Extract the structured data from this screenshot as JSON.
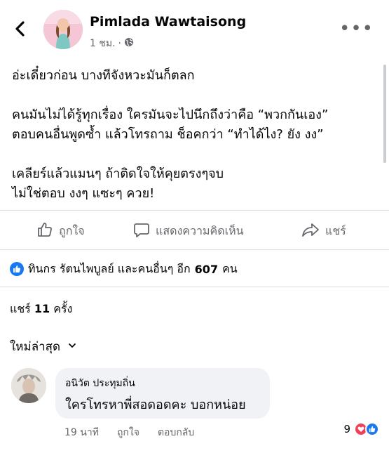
{
  "header": {
    "author": "Pimlada Wawtaisong",
    "time": "1 ชม.",
    "separator": "·",
    "more_label": "•••"
  },
  "post": {
    "lines": [
      "อ่ะเดี๋ยวก่อน บางทีจังหวะมันก็ตลก",
      "",
      "คนมันไม่ได้รู้ทุกเรื่อง ใครมันจะไปนึกถึงว่าคือ “พวกกันเอง”",
      "ตอบคนอื่นพูดซ้ำ แล้วโทรถาม ช็อคกว่า “ทำได้ไง? ยัง งง”",
      "",
      "เคลียร์แล้วแมนๆ ถ้าติดใจให้คุยตรงๆจบ",
      "ไม่ใช่ตอบ งงๆ แซะๆ ควย!"
    ]
  },
  "actions": {
    "like": "ถูกใจ",
    "comment": "แสดงความคิดเห็น",
    "share": "แชร์"
  },
  "reactions": {
    "text": "ทินกร รัตนไพบูลย์ และคนอื่นๆ อีก",
    "count": "607",
    "unit": "คน"
  },
  "shares": {
    "prefix": "แชร์",
    "count": "11",
    "suffix": "ครั้ง"
  },
  "sort": {
    "label": "ใหม่ล่าสุด"
  },
  "comment": {
    "name": "อนิวัต ประทุมถิ่น",
    "text": "ใครโทรหาพี่สอดอดคะ บอกหน่อย",
    "time": "19 นาที",
    "like": "ถูกใจ",
    "reply": "ตอบกลับ",
    "reaction_count": "9"
  },
  "colors": {
    "brand": "#1877f2",
    "love": "#f33e58",
    "muted": "#65676b"
  }
}
